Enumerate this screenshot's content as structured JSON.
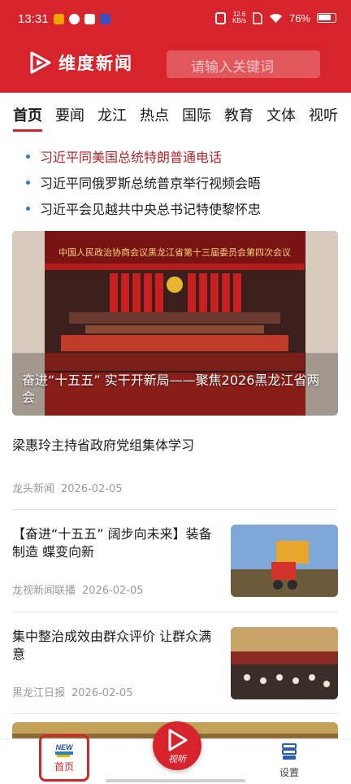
{
  "status_bar": {
    "time": "13:31",
    "net_speed_value": "12.6",
    "net_speed_unit": "KB/s",
    "battery": "76%"
  },
  "header": {
    "app_name": "维度新闻",
    "search_placeholder": "请输入关键词",
    "brand_color": "#d7232b"
  },
  "tabs": [
    {
      "label": "首页",
      "active": true
    },
    {
      "label": "要闻"
    },
    {
      "label": "龙江"
    },
    {
      "label": "热点"
    },
    {
      "label": "国际"
    },
    {
      "label": "教育"
    },
    {
      "label": "文体"
    },
    {
      "label": "视听"
    }
  ],
  "headlines": [
    "习近平同美国总统特朗普通电话",
    "习近平同俄罗斯总统普京举行视频会晤",
    "习近平会见越共中央总书记特使黎怀忠"
  ],
  "banner": {
    "caption": "奋进“十五五” 实干开新局——聚焦2026黑龙江省两会",
    "backdrop_text": "中国人民政治协商会议黑龙江省第十三届委员会第四次会议"
  },
  "news": [
    {
      "title": "梁惠玲主持省政府党组集体学习",
      "source": "龙头新闻",
      "date": "2026-02-05"
    },
    {
      "title": "【奋进“十五五” 阔步向未来】装备制造 蝶变向新",
      "source": "龙视新闻联播",
      "date": "2026-02-05"
    },
    {
      "title": "集中整治成效由群众评价 让群众满意",
      "source": "黑龙江日报",
      "date": "2026-02-05"
    }
  ],
  "bottom_nav": {
    "home": "首页",
    "home_badge": "NEW",
    "listen": "视听",
    "settings": "设置"
  }
}
